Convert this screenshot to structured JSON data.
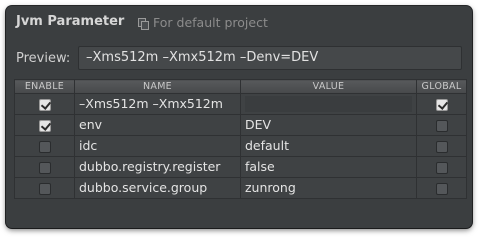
{
  "window": {
    "title": "Jvm Parameter",
    "scope_label": "For default project",
    "scope_icon": "copy-icon"
  },
  "preview": {
    "label": "Preview:",
    "value": "–Xms512m –Xmx512m –Denv=DEV"
  },
  "table": {
    "columns": [
      "ENABLE",
      "NAME",
      "VALUE",
      "GLOBAL"
    ],
    "rows": [
      {
        "enable": true,
        "name": "–Xms512m –Xmx512m",
        "value": "",
        "global": true
      },
      {
        "enable": true,
        "name": "env",
        "value": "DEV",
        "global": false
      },
      {
        "enable": false,
        "name": "idc",
        "value": "default",
        "global": false
      },
      {
        "enable": false,
        "name": "dubbo.registry.register",
        "value": "false",
        "global": false
      },
      {
        "enable": false,
        "name": "dubbo.service.group",
        "value": "zunrong",
        "global": false
      }
    ]
  },
  "colors": {
    "panel_bg": "#3b3e40",
    "checkbox_on": "#e6e6e6"
  }
}
